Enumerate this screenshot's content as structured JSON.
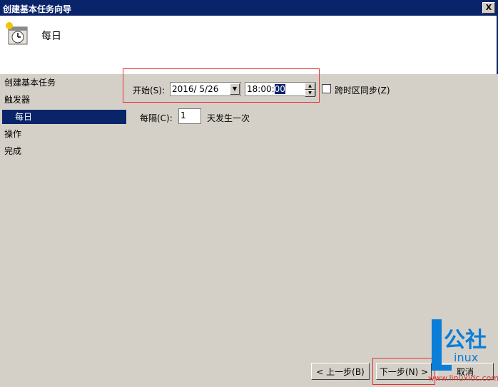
{
  "window": {
    "title": "创建基本任务向导",
    "close_glyph": "X"
  },
  "header": {
    "title": "每日",
    "icon": "clock-calendar-icon"
  },
  "sidebar": {
    "items": [
      {
        "label": "创建基本任务"
      },
      {
        "label": "触发器"
      },
      {
        "label": "每日"
      },
      {
        "label": "操作"
      },
      {
        "label": "完成"
      }
    ]
  },
  "form": {
    "start_label": "开始(S):",
    "start_date": "2016/ 5/26",
    "start_time_prefix": "18:00:",
    "start_time_selected": "00",
    "sync_label": "跨时区同步(Z)",
    "sync_checked": false,
    "every_label": "每隔(C):",
    "every_value": "1",
    "every_suffix": "天发生一次"
  },
  "buttons": {
    "back": "< 上一步(B)",
    "next": "下一步(N) >",
    "cancel": "取消"
  },
  "watermark": {
    "brand": "公社",
    "sub": "inux",
    "url": "www.linuxidc.com"
  },
  "colors": {
    "titlebar": "#0a246a",
    "highlight": "#e23030",
    "watermark": "#0a7ed8"
  }
}
